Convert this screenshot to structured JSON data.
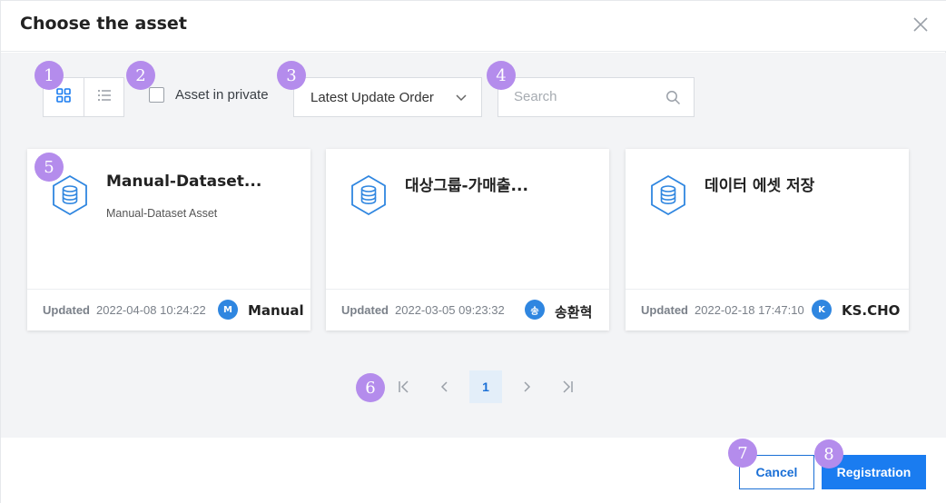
{
  "dialog": {
    "title": "Choose the asset"
  },
  "toolbar": {
    "private_label": "Asset in private",
    "sort_selected": "Latest Update Order",
    "search_placeholder": "Search",
    "search_value": ""
  },
  "cards": [
    {
      "name": "Manual-Dataset...",
      "description": "Manual-Dataset Asset",
      "updated_label": "Updated",
      "updated": "2022-04-08 10:24:22",
      "avatar_letter": "M",
      "owner": "Manual"
    },
    {
      "name": "대상그룹-가매출...",
      "description": "",
      "updated_label": "Updated",
      "updated": "2022-03-05 09:23:32",
      "avatar_letter": "송",
      "owner": "송환혁"
    },
    {
      "name": "데이터 에셋 저장",
      "description": "",
      "updated_label": "Updated",
      "updated": "2022-02-18 17:47:10",
      "avatar_letter": "K",
      "owner": "KS.CHO"
    }
  ],
  "pagination": {
    "current": "1"
  },
  "footer": {
    "cancel_label": "Cancel",
    "register_label": "Registration"
  },
  "badges": [
    "1",
    "2",
    "3",
    "4",
    "5",
    "6",
    "7",
    "8"
  ],
  "colors": {
    "accent": "#1a7cf0",
    "avatar": "#2f86e0",
    "badge": "#b48cec",
    "panel": "#f3f4f6"
  },
  "icons": {
    "grid_view": "grid-view-icon",
    "list_view": "list-view-icon",
    "close": "close-icon",
    "search": "search-icon",
    "dataset": "database-hexagon-icon"
  }
}
